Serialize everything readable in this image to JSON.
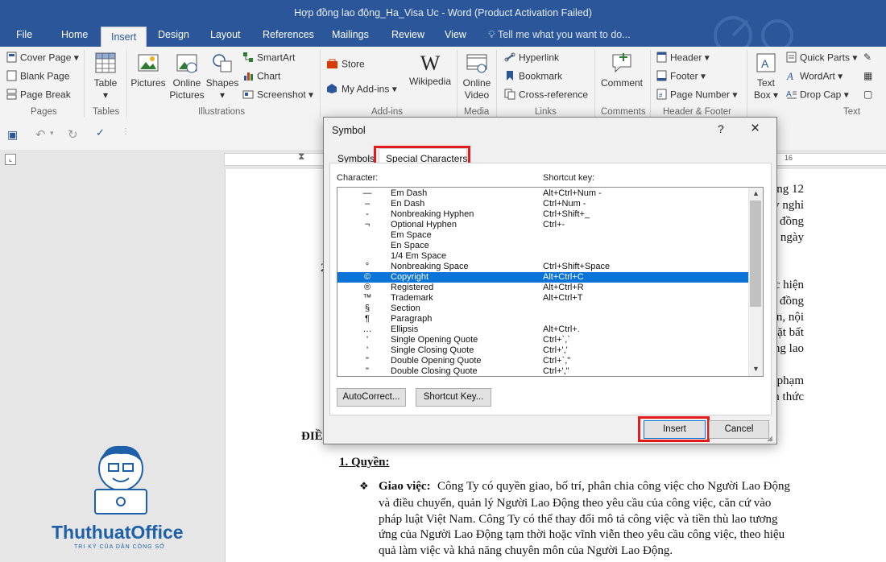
{
  "window": {
    "title": "Hợp đồng lao động_Ha_Visa Uc  -  Word (Product Activation Failed)"
  },
  "tabs": [
    "File",
    "Home",
    "Insert",
    "Design",
    "Layout",
    "References",
    "Mailings",
    "Review",
    "View"
  ],
  "tell_me": "Tell me what you want to do...",
  "ribbon": {
    "pages": {
      "cover_page": "Cover Page",
      "blank_page": "Blank Page",
      "page_break": "Page Break",
      "group": "Pages"
    },
    "tables": {
      "table": "Table",
      "group": "Tables"
    },
    "illustrations": {
      "pictures": "Pictures",
      "online_pictures_1": "Online",
      "online_pictures_2": "Pictures",
      "shapes": "Shapes",
      "smartart": "SmartArt",
      "chart": "Chart",
      "screenshot": "Screenshot",
      "group": "Illustrations"
    },
    "addins": {
      "store": "Store",
      "my_addins": "My Add-ins",
      "wikipedia": "Wikipedia",
      "group": "Add-ins"
    },
    "media": {
      "online_video_1": "Online",
      "online_video_2": "Video",
      "group": "Media"
    },
    "links": {
      "hyperlink": "Hyperlink",
      "bookmark": "Bookmark",
      "cross_reference": "Cross-reference",
      "group": "Links"
    },
    "comments": {
      "comment": "Comment",
      "group": "Comments"
    },
    "header_footer": {
      "header": "Header",
      "footer": "Footer",
      "page_number": "Page Number",
      "group": "Header & Footer"
    },
    "text": {
      "text_box_1": "Text",
      "text_box_2": "Box",
      "quick_parts": "Quick Parts",
      "wordart": "WordArt",
      "drop_cap": "Drop Cap",
      "group": "Text"
    }
  },
  "document": {
    "right_fragments": [
      "ng 12",
      "y nghỉ",
      "đồng",
      "ngày",
      "c hiện",
      "đồng",
      "n, nội",
      "ặt bất",
      "ng lao",
      "phạm",
      "n thức"
    ],
    "num_2": "2",
    "heading_fragment": "ĐIỀ",
    "section_1": "1. Quyền:",
    "bullet_title": "Giao việc:",
    "bullet_lines": [
      "Công Ty có quyền giao, bố trí, phân chia công việc cho Người Lao Động",
      "và điều chuyển, quản lý Người Lao Động theo yêu cầu của công việc, căn cứ vào",
      "pháp luật Việt Nam. Công Ty có thể thay đổi mô tả công việc và tiền thù lao tương",
      "ứng của Người Lao Động tạm thời hoặc vĩnh viễn theo yêu cầu công việc, theo hiệu",
      "quả làm việc và khả năng chuyên môn của Người Lao Động."
    ]
  },
  "dialog": {
    "title": "Symbol",
    "help": "?",
    "close": "×",
    "tab_symbols": "Symbols",
    "tab_special": "Special Characters",
    "col_character": "Character:",
    "col_shortcut": "Shortcut key:",
    "rows": [
      {
        "glyph": "—",
        "name": "Em Dash",
        "key": "Alt+Ctrl+Num -"
      },
      {
        "glyph": "–",
        "name": "En Dash",
        "key": "Ctrl+Num -"
      },
      {
        "glyph": "-",
        "name": "Nonbreaking Hyphen",
        "key": "Ctrl+Shift+_"
      },
      {
        "glyph": "¬",
        "name": "Optional Hyphen",
        "key": "Ctrl+-"
      },
      {
        "glyph": "",
        "name": "Em Space",
        "key": ""
      },
      {
        "glyph": "",
        "name": "En Space",
        "key": ""
      },
      {
        "glyph": "",
        "name": "1/4 Em Space",
        "key": ""
      },
      {
        "glyph": "°",
        "name": "Nonbreaking Space",
        "key": "Ctrl+Shift+Space"
      },
      {
        "glyph": "©",
        "name": "Copyright",
        "key": "Alt+Ctrl+C"
      },
      {
        "glyph": "®",
        "name": "Registered",
        "key": "Alt+Ctrl+R"
      },
      {
        "glyph": "™",
        "name": "Trademark",
        "key": "Alt+Ctrl+T"
      },
      {
        "glyph": "§",
        "name": "Section",
        "key": ""
      },
      {
        "glyph": "¶",
        "name": "Paragraph",
        "key": ""
      },
      {
        "glyph": "…",
        "name": "Ellipsis",
        "key": "Alt+Ctrl+."
      },
      {
        "glyph": "'",
        "name": "Single Opening Quote",
        "key": "Ctrl+`,`"
      },
      {
        "glyph": "'",
        "name": "Single Closing Quote",
        "key": "Ctrl+','"
      },
      {
        "glyph": "\"",
        "name": "Double Opening Quote",
        "key": "Ctrl+`,\""
      },
      {
        "glyph": "\"",
        "name": "Double Closing Quote",
        "key": "Ctrl+',\""
      }
    ],
    "selected_index": 8,
    "autocorrect": "AutoCorrect...",
    "shortcut_key": "Shortcut Key...",
    "insert": "Insert",
    "cancel": "Cancel"
  },
  "watermark": {
    "brand": "ThuthuatOffice",
    "tagline": "TRI KỶ CỦA DÂN CÔNG SỞ"
  },
  "colors": {
    "title_bar": "#2b579a",
    "selection": "#0a74d9",
    "highlight": "#e31b1b"
  }
}
